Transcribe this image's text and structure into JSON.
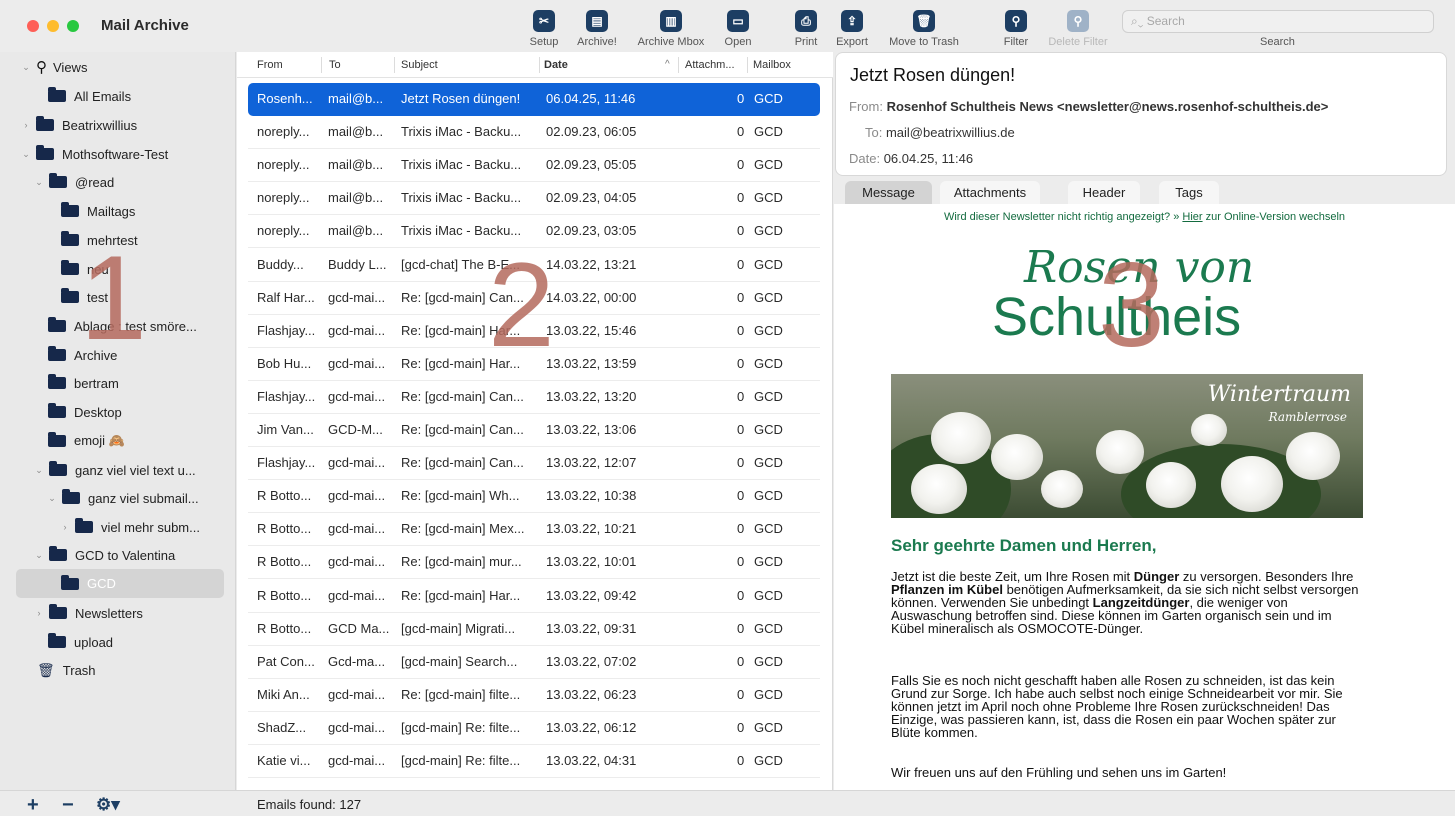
{
  "window": {
    "title": "Mail Archive"
  },
  "colors": {
    "accent": "#0f63d8",
    "toolbar_icon": "#1d3e63",
    "newsletter_green": "#1b7a4f",
    "annotation": "#b56a5e"
  },
  "toolbar": {
    "setup": "Setup",
    "archive": "Archive!",
    "archive_mbox": "Archive Mbox",
    "open": "Open",
    "print": "Print",
    "export": "Export",
    "move_to_trash": "Move to Trash",
    "filter": "Filter",
    "delete_filter": "Delete Filter",
    "search_placeholder": "Search",
    "search_label": "Search"
  },
  "sidebar": {
    "views": "Views",
    "all_emails": "All Emails",
    "beatrixwillius": "Beatrixwillius",
    "mothsoftware": "Mothsoftware-Test",
    "read": "@read",
    "mailtags": "Mailtags",
    "mehrtest": "mehrtest",
    "neu": "neu",
    "test": "test",
    "ablage": "Ablage : test smöre...",
    "archive": "Archive",
    "bertram": "bertram",
    "desktop": "Desktop",
    "emoji": "emoji 🙈",
    "ganz": "ganz viel viel text u...",
    "ganz_sub": "ganz viel submail...",
    "viel_mehr": "viel mehr subm...",
    "gcd_valentina": "GCD to Valentina",
    "gcd": "GCD",
    "newsletters": "Newsletters",
    "upload": "upload",
    "trash": "Trash"
  },
  "list": {
    "headers": {
      "from": "From",
      "to": "To",
      "subject": "Subject",
      "date": "Date",
      "attachments": "Attachm...",
      "mailbox": "Mailbox"
    },
    "rows": [
      {
        "from": "Rosenh...",
        "to": "mail@b...",
        "subject": "Jetzt Rosen düngen!",
        "date": "06.04.25, 11:46",
        "att": "0",
        "mailbox": "GCD"
      },
      {
        "from": "noreply...",
        "to": "mail@b...",
        "subject": "Trixis iMac - Backu...",
        "date": "02.09.23, 06:05",
        "att": "0",
        "mailbox": "GCD"
      },
      {
        "from": "noreply...",
        "to": "mail@b...",
        "subject": "Trixis iMac - Backu...",
        "date": "02.09.23, 05:05",
        "att": "0",
        "mailbox": "GCD"
      },
      {
        "from": "noreply...",
        "to": "mail@b...",
        "subject": "Trixis iMac - Backu...",
        "date": "02.09.23, 04:05",
        "att": "0",
        "mailbox": "GCD"
      },
      {
        "from": "noreply...",
        "to": "mail@b...",
        "subject": "Trixis iMac - Backu...",
        "date": "02.09.23, 03:05",
        "att": "0",
        "mailbox": "GCD"
      },
      {
        "from": "Buddy...",
        "to": "Buddy L...",
        "subject": "[gcd-chat] The B-E...",
        "date": "14.03.22, 13:21",
        "att": "0",
        "mailbox": "GCD"
      },
      {
        "from": "Ralf Har...",
        "to": "gcd-mai...",
        "subject": "Re: [gcd-main] Can...",
        "date": "14.03.22, 00:00",
        "att": "0",
        "mailbox": "GCD"
      },
      {
        "from": "Flashjay...",
        "to": "gcd-mai...",
        "subject": "Re: [gcd-main] Har...",
        "date": "13.03.22, 15:46",
        "att": "0",
        "mailbox": "GCD"
      },
      {
        "from": "Bob Hu...",
        "to": "gcd-mai...",
        "subject": "Re: [gcd-main] Har...",
        "date": "13.03.22, 13:59",
        "att": "0",
        "mailbox": "GCD"
      },
      {
        "from": "Flashjay...",
        "to": "gcd-mai...",
        "subject": "Re: [gcd-main] Can...",
        "date": "13.03.22, 13:20",
        "att": "0",
        "mailbox": "GCD"
      },
      {
        "from": "Jim Van...",
        "to": "GCD-M...",
        "subject": "Re: [gcd-main] Can...",
        "date": "13.03.22, 13:06",
        "att": "0",
        "mailbox": "GCD"
      },
      {
        "from": "Flashjay...",
        "to": "gcd-mai...",
        "subject": "Re: [gcd-main] Can...",
        "date": "13.03.22, 12:07",
        "att": "0",
        "mailbox": "GCD"
      },
      {
        "from": "R Botto...",
        "to": "gcd-mai...",
        "subject": "Re: [gcd-main] Wh...",
        "date": "13.03.22, 10:38",
        "att": "0",
        "mailbox": "GCD"
      },
      {
        "from": "R Botto...",
        "to": "gcd-mai...",
        "subject": "Re: [gcd-main] Mex...",
        "date": "13.03.22, 10:21",
        "att": "0",
        "mailbox": "GCD"
      },
      {
        "from": "R Botto...",
        "to": "gcd-mai...",
        "subject": "Re: [gcd-main] mur...",
        "date": "13.03.22, 10:01",
        "att": "0",
        "mailbox": "GCD"
      },
      {
        "from": "R Botto...",
        "to": "gcd-mai...",
        "subject": "Re: [gcd-main] Har...",
        "date": "13.03.22, 09:42",
        "att": "0",
        "mailbox": "GCD"
      },
      {
        "from": "R Botto...",
        "to": "GCD Ma...",
        "subject": "[gcd-main] Migrati...",
        "date": "13.03.22, 09:31",
        "att": "0",
        "mailbox": "GCD"
      },
      {
        "from": "Pat Con...",
        "to": "Gcd-ma...",
        "subject": "[gcd-main] Search...",
        "date": "13.03.22, 07:02",
        "att": "0",
        "mailbox": "GCD"
      },
      {
        "from": "Miki An...",
        "to": "gcd-mai...",
        "subject": "Re: [gcd-main] filte...",
        "date": "13.03.22, 06:23",
        "att": "0",
        "mailbox": "GCD"
      },
      {
        "from": "ShadZ...",
        "to": "gcd-mai...",
        "subject": "[gcd-main] Re: filte...",
        "date": "13.03.22, 06:12",
        "att": "0",
        "mailbox": "GCD"
      },
      {
        "from": "Katie vi...",
        "to": "gcd-mai...",
        "subject": "[gcd-main] Re: filte...",
        "date": "13.03.22, 04:31",
        "att": "0",
        "mailbox": "GCD"
      }
    ]
  },
  "message": {
    "subject": "Jetzt Rosen düngen!",
    "from_label": "From:",
    "from": "Rosenhof Schultheis News <newsletter@news.rosenhof-schultheis.de>",
    "to_label": "To:",
    "to": "mail@beatrixwillius.de",
    "date_label": "Date:",
    "date": "06.04.25, 11:46",
    "tabs": {
      "message": "Message",
      "attachments": "Attachments",
      "header": "Header",
      "tags": "Tags"
    },
    "online_pre": "Wird dieser Newsletter nicht richtig angezeigt? » ",
    "online_link": "Hier",
    "online_post": " zur Online-Version wechseln",
    "logo_line1": "Rosen von",
    "logo_line2": "Schultheis",
    "banner_title": "Wintertraum",
    "banner_sub": "Ramblerrose",
    "greeting": "Sehr geehrte Damen und Herren,",
    "p1_a": "Jetzt ist die beste Zeit, um Ihre Rosen mit ",
    "p1_b": "Dünger",
    "p1_c": " zu versorgen. Besonders Ihre ",
    "p1_d": "Pflanzen im Kübel",
    "p1_e": " benötigen Aufmerksamkeit, da sie sich nicht selbst versorgen können. Verwenden Sie unbedingt ",
    "p1_f": "Langzeitdünger",
    "p1_g": ", die weniger von Auswaschung betroffen sind. Diese können im Garten organisch sein und im Kübel mineralisch als OSMOCOTE-Dünger.",
    "p2": "Falls Sie es noch nicht geschafft haben alle Rosen zu schneiden, ist das kein Grund zur Sorge. Ich habe auch selbst noch einige Schneidearbeit vor mir. Sie können jetzt im April noch ohne Probleme Ihre Rosen zurückschneiden! Das Einzige, was passieren kann, ist, dass die Rosen ein paar Wochen später zur Blüte kommen.",
    "p3": "Wir freuen uns auf den Frühling und sehen uns im Garten!"
  },
  "annotations": {
    "n1": "1",
    "n2": "2",
    "n3": "3"
  },
  "status": {
    "emails_found": "Emails found: 127"
  }
}
